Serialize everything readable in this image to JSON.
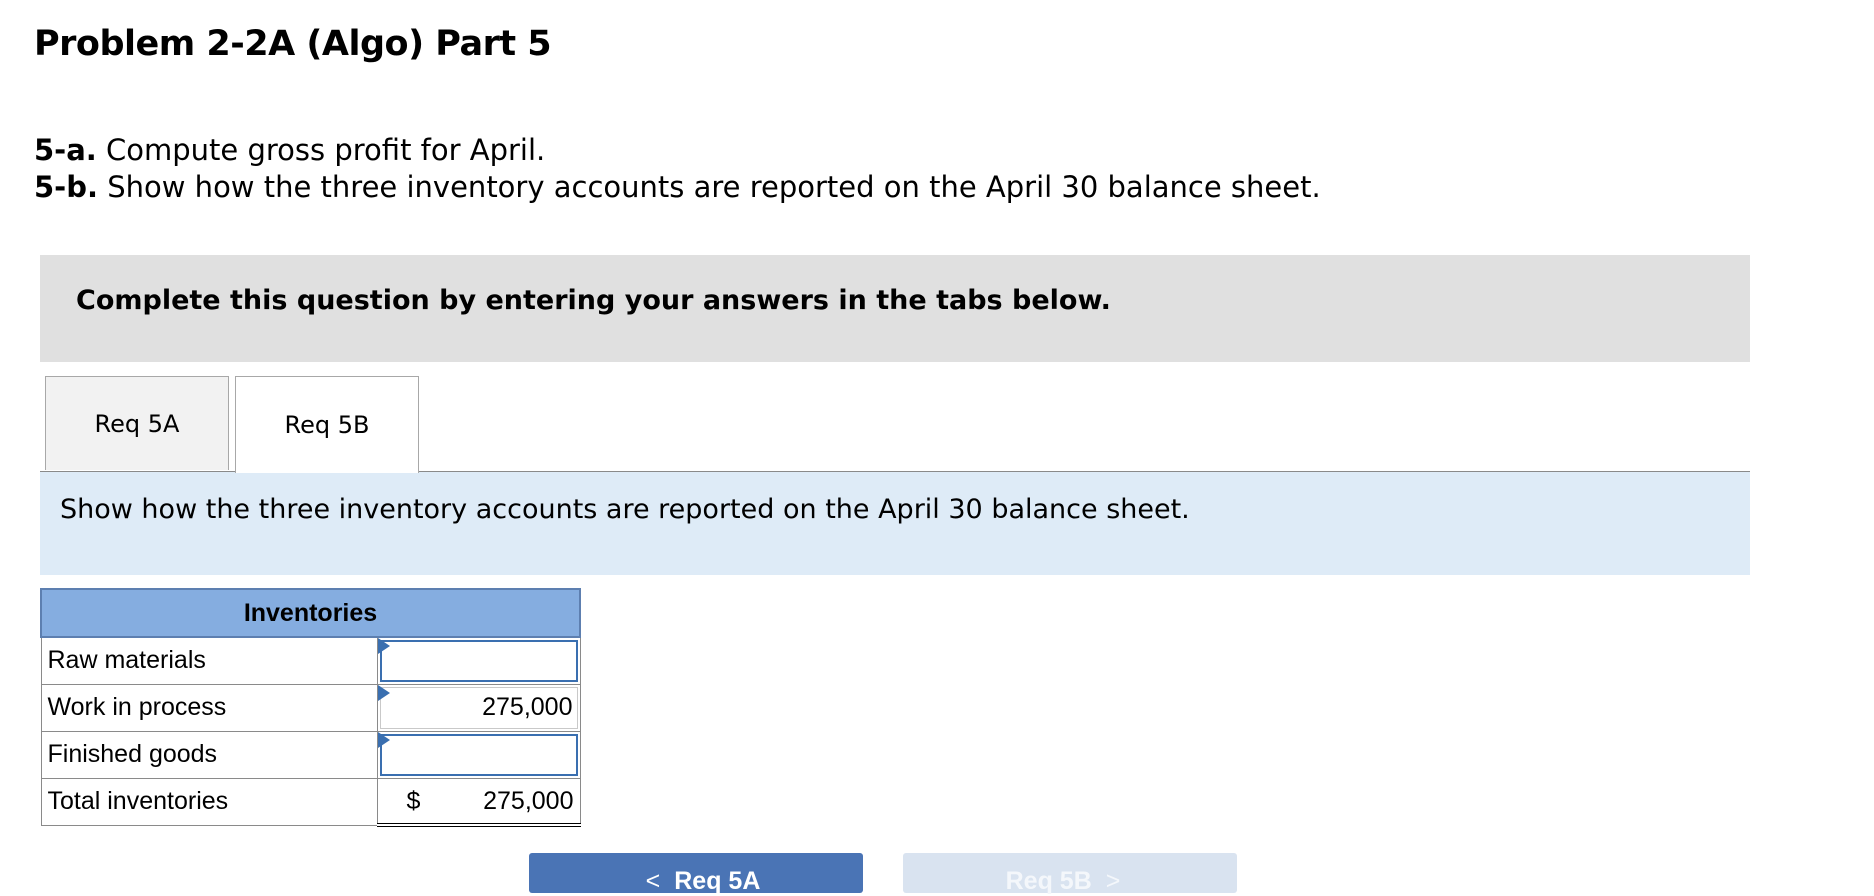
{
  "page_title": "Problem 2-2A (Algo) Part 5",
  "instructions": [
    {
      "label": "5-a.",
      "text": " Compute gross profit for April."
    },
    {
      "label": "5-b.",
      "text": " Show how the three inventory accounts are reported on the April 30 balance sheet."
    }
  ],
  "banner": "Complete this question by entering your answers in the tabs below.",
  "tabs": [
    {
      "label": "Req 5A",
      "active": false
    },
    {
      "label": "Req 5B",
      "active": true
    }
  ],
  "prompt": "Show how the three inventory accounts are reported on the April 30 balance sheet.",
  "table": {
    "header": "Inventories",
    "rows": [
      {
        "label": "Raw materials",
        "value": ""
      },
      {
        "label": "Work in process",
        "value": "275,000"
      },
      {
        "label": "Finished goods",
        "value": ""
      }
    ],
    "total": {
      "label": "Total inventories",
      "currency": "$",
      "value": "275,000"
    }
  },
  "nav": {
    "prev_label": "Req 5A",
    "next_label": "Req 5B",
    "prev_chevron": "<",
    "next_chevron": ">"
  },
  "colors": {
    "table_header": "#85ade0",
    "prompt_bg": "#deebf7",
    "banner_bg": "#e0e0e0",
    "prev_button": "#4a74b5",
    "next_button_disabled": "#d9e3f0"
  }
}
